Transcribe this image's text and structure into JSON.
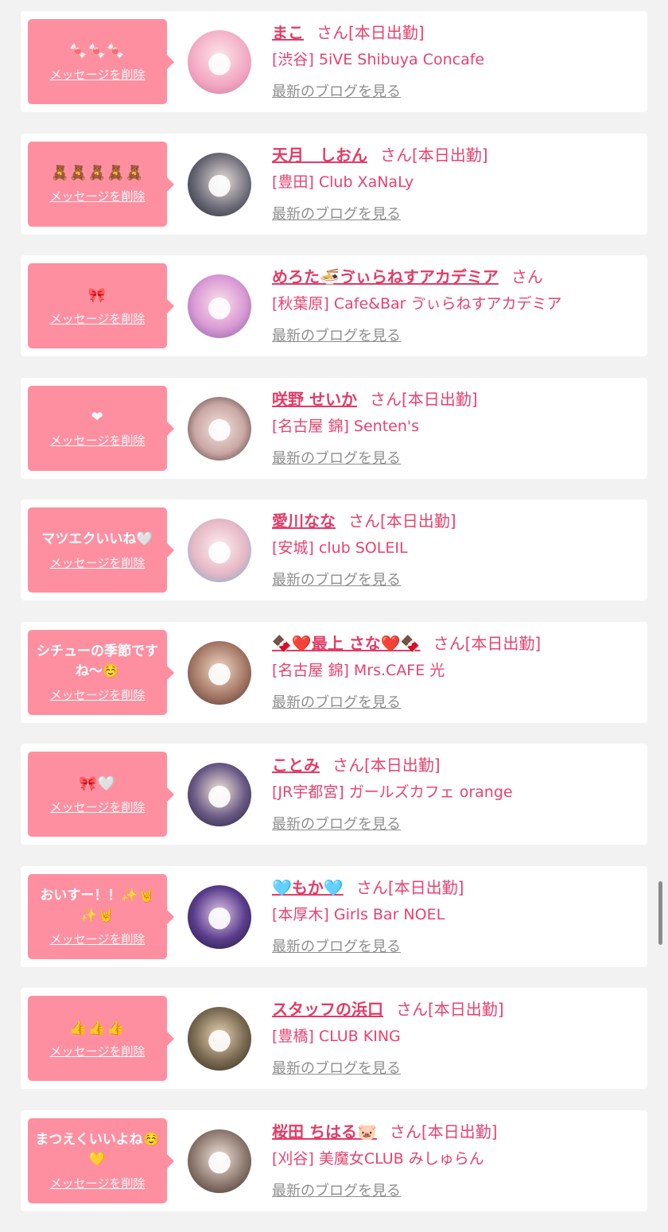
{
  "delete_label": "メッセージを削除",
  "blog_label": "最新のブログを見る",
  "san_label": "さん",
  "cards": [
    {
      "message": "🍬🍬🍬",
      "name": "まこ",
      "badge": "[本日出勤]",
      "shop": "[渋谷] 5iVE Shibuya Concafe",
      "avatar": "#f2a6c1"
    },
    {
      "message": "🧸🧸🧸🧸🧸",
      "name": "天月　しおん",
      "badge": "[本日出勤]",
      "shop": "[豊田] Club XaNaLy",
      "avatar": "#3a3a44"
    },
    {
      "message": "🎀",
      "name": "めろた🍜ゔぃらねすアカデミア",
      "badge": "",
      "shop": "[秋葉原] Cafe&Bar ゔぃらねすアカデミア",
      "avatar": "#d99ad4"
    },
    {
      "message": "❤",
      "name": "咲野 せいか",
      "badge": "[本日出勤]",
      "shop": "[名古屋 錦] Senten's",
      "avatar": "#c9a7a4"
    },
    {
      "message": "マツエクいいね🤍",
      "name": "愛川なな",
      "badge": "[本日出勤]",
      "shop": "[安城] club SOLEIL",
      "avatar": "#e7b9c6"
    },
    {
      "message": "シチューの季節ですね〜☺️",
      "name": "🍫❤️最上 さな❤️🍫",
      "badge": "[本日出勤]",
      "shop": "[名古屋 錦] Mrs.CAFE 光",
      "avatar": "#a67a68"
    },
    {
      "message": "🎀🤍",
      "name": "ことみ",
      "badge": "[本日出勤]",
      "shop": "[JR宇都宮] ガールズカフェ orange",
      "avatar": "#6a5a86"
    },
    {
      "message": "おいすー！！✨🤘✨🤘",
      "name": "🩵もか🩵",
      "badge": "[本日出勤]",
      "shop": "[本厚木] Girls Bar NOEL",
      "avatar": "#5b3d8c"
    },
    {
      "message": "👍👍👍",
      "name": "スタッフの浜口",
      "badge": "[本日出勤]",
      "shop": "[豊橋] CLUB KING",
      "avatar": "#7a6a52"
    },
    {
      "message": "まつえくいいよね☺️💛",
      "name": "桜田 ちはる🐷",
      "badge": "[本日出勤]",
      "shop": "[刈谷] 美魔女CLUB みしゅらん",
      "avatar": "#8e7a70"
    }
  ]
}
